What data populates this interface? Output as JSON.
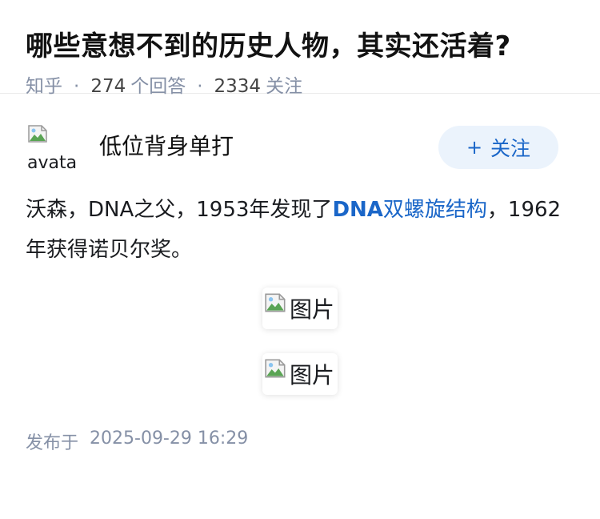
{
  "question": {
    "title": "哪些意想不到的历史人物，其实还活着?",
    "source": "知乎",
    "answer_count": "274",
    "answer_count_label": "个回答",
    "follower_count": "2334",
    "follower_label": "关注"
  },
  "answer": {
    "author": {
      "name": "低位背身单打",
      "avatar_alt": "avatar"
    },
    "follow_button": {
      "plus": "+",
      "label": "关注"
    },
    "content": {
      "part1": "沃森，DNA之父，1953年发现了",
      "link_bold": "DNA",
      "link_rest": "双螺旋结构",
      "part2": "，1962年获得诺贝尔奖。"
    },
    "images": [
      {
        "alt": "图片"
      },
      {
        "alt": "图片"
      }
    ],
    "publish": {
      "label": "发布于",
      "datetime": "2025-09-29 16:29"
    }
  },
  "colors": {
    "link": "#1a66c8",
    "meta": "#8590a6",
    "follow_bg": "#ebf3fc"
  }
}
